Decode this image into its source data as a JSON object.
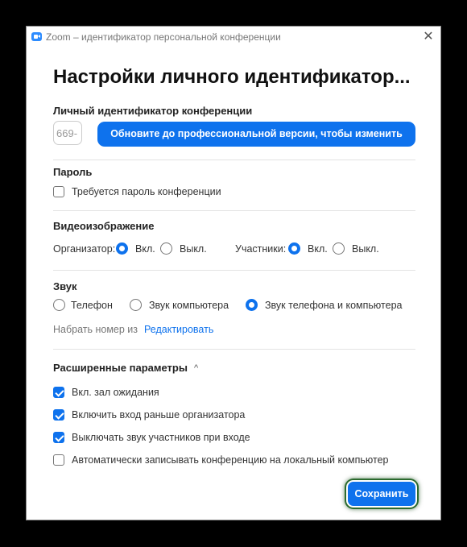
{
  "window": {
    "title": "Zoom – идентификатор персональной конференции",
    "close_glyph": "✕"
  },
  "heading": "Настройки личного идентификатор...",
  "meeting_id": {
    "label": "Личный идентификатор конференции",
    "value": "669-",
    "upgrade_button": "Обновите до профессиональной версии, чтобы изменить"
  },
  "password": {
    "label": "Пароль",
    "require_label": "Требуется пароль конференции",
    "require_checked": false
  },
  "video": {
    "label": "Видеоизображение",
    "host_label": "Организатор:",
    "participants_label": "Участники:",
    "on_label": "Вкл.",
    "off_label": "Выкл.",
    "host_value": "on",
    "participants_value": "on"
  },
  "audio": {
    "label": "Звук",
    "options": [
      "Телефон",
      "Звук компьютера",
      "Звук телефона и компьютера"
    ],
    "selected": 2,
    "dial_in_label": "Набрать номер из",
    "edit_link": "Редактировать"
  },
  "advanced": {
    "label": "Расширенные параметры",
    "toggle_glyph": "^",
    "options": [
      {
        "label": "Вкл. зал ожидания",
        "checked": true
      },
      {
        "label": "Включить вход раньше организатора",
        "checked": true
      },
      {
        "label": "Выключать звук участников при входе",
        "checked": true
      },
      {
        "label": "Автоматически записывать конференцию на локальный компьютер",
        "checked": false
      }
    ]
  },
  "save_button": "Сохранить",
  "colors": {
    "accent": "#0e72ed",
    "background": "#000000",
    "focus_ring": "#2b6a2e"
  }
}
